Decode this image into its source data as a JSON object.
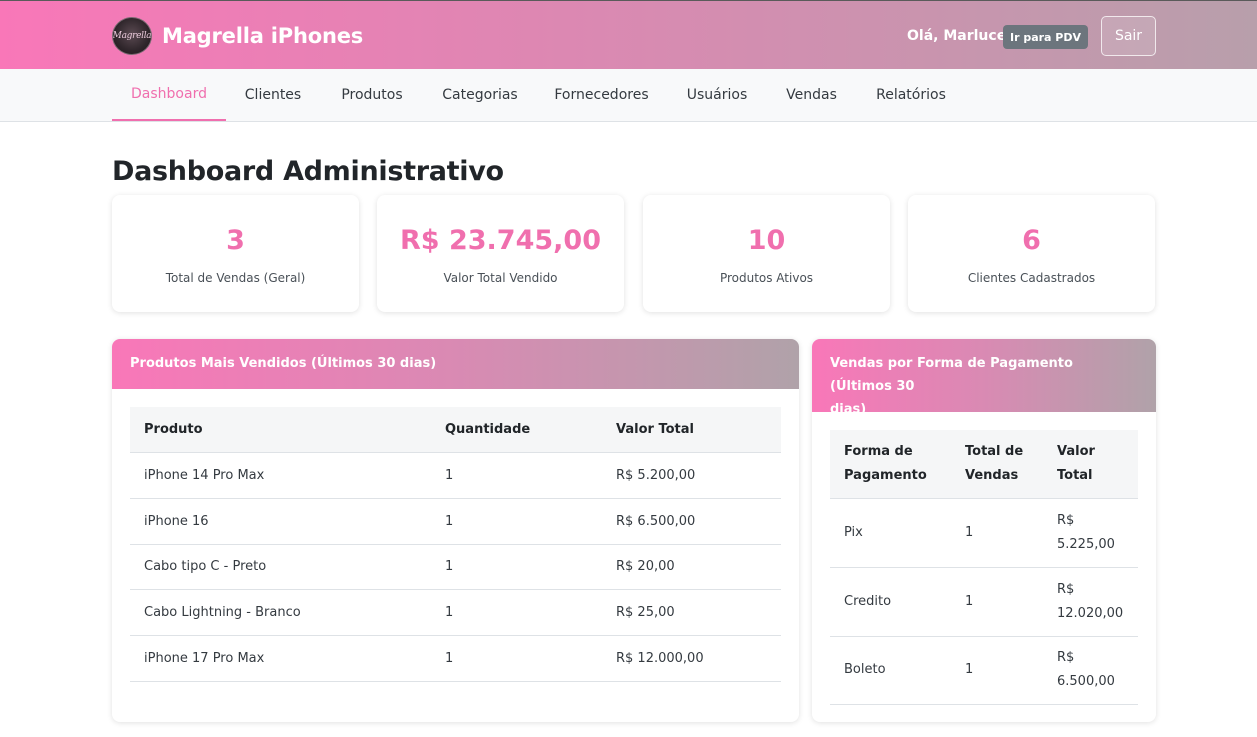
{
  "header": {
    "logo_text": "Magrella",
    "brand": "Magrella iPhones",
    "greeting": "Olá, Marluce",
    "pdv_button": "Ir para PDV",
    "logout_button": "Sair",
    "gradient_colors": [
      "#f977b8",
      "#b89fab"
    ]
  },
  "nav": {
    "items": [
      {
        "label": "Dashboard",
        "active": true
      },
      {
        "label": "Clientes"
      },
      {
        "label": "Produtos"
      },
      {
        "label": "Categorias"
      },
      {
        "label": "Fornecedores"
      },
      {
        "label": "Usuários"
      },
      {
        "label": "Vendas"
      },
      {
        "label": "Relatórios"
      }
    ]
  },
  "page": {
    "title": "Dashboard Administrativo",
    "accent_color": "#f06fae"
  },
  "stats": [
    {
      "value": "3",
      "label": "Total de Vendas (Geral)"
    },
    {
      "value": "R$ 23.745,00",
      "label": "Valor Total Vendido"
    },
    {
      "value": "10",
      "label": "Produtos Ativos"
    },
    {
      "value": "6",
      "label": "Clientes Cadastrados"
    }
  ],
  "top_products": {
    "title": "Produtos Mais Vendidos (Últimos 30 dias)",
    "columns": [
      "Produto",
      "Quantidade",
      "Valor Total"
    ],
    "rows": [
      [
        "iPhone 14 Pro Max",
        "1",
        "R$ 5.200,00"
      ],
      [
        "iPhone 16",
        "1",
        "R$ 6.500,00"
      ],
      [
        "Cabo tipo C - Preto",
        "1",
        "R$ 20,00"
      ],
      [
        "Cabo Lightning - Branco",
        "1",
        "R$ 25,00"
      ],
      [
        "iPhone 17 Pro Max",
        "1",
        "R$ 12.000,00"
      ]
    ]
  },
  "payments": {
    "title_line1": "Vendas por Forma de Pagamento (Últimos 30",
    "title_line2": "dias)",
    "columns": [
      [
        "Forma de",
        "Pagamento"
      ],
      [
        "Total de",
        "Vendas"
      ],
      [
        "Valor",
        "Total"
      ]
    ],
    "rows": [
      {
        "method": "Pix",
        "count": "1",
        "value_line1": "R$",
        "value_line2": "5.225,00"
      },
      {
        "method": "Credito",
        "count": "1",
        "value_line1": "R$",
        "value_line2": "12.020,00"
      },
      {
        "method": "Boleto",
        "count": "1",
        "value_line1": "R$",
        "value_line2": "6.500,00"
      }
    ]
  }
}
